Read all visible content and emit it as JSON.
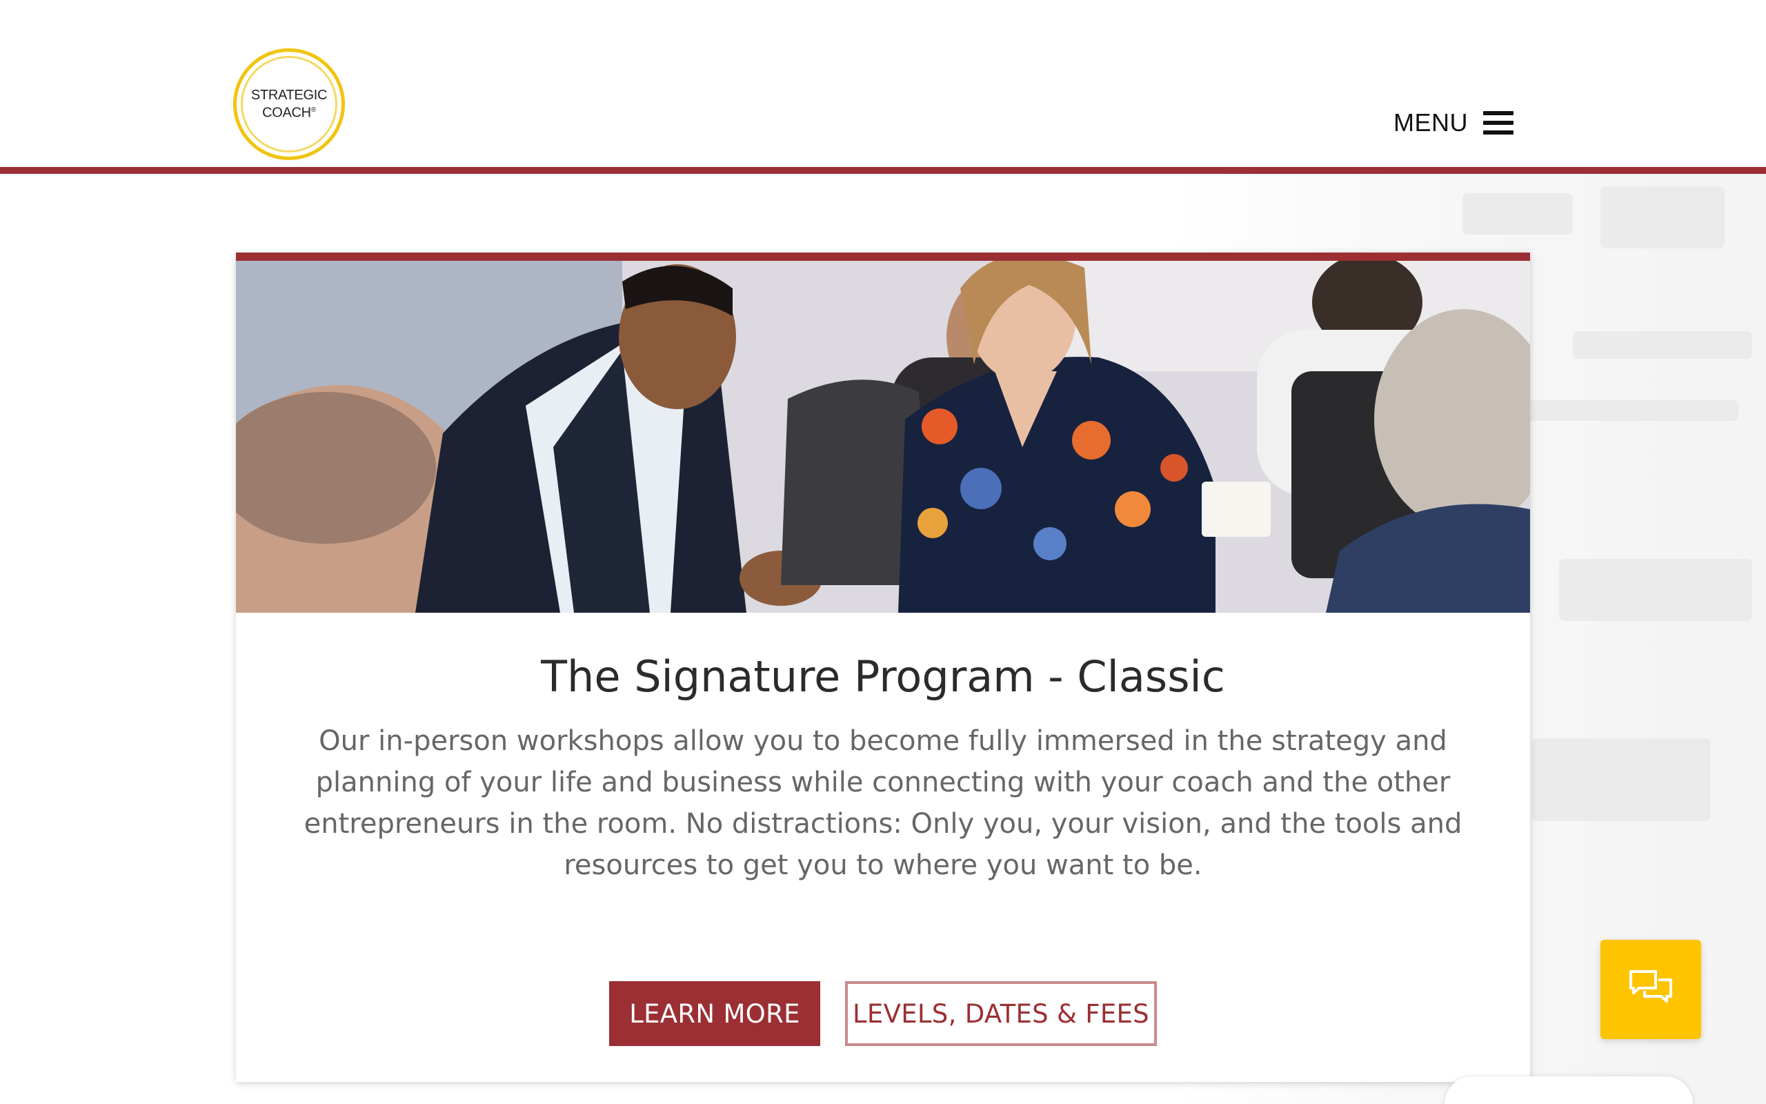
{
  "header": {
    "logo_line1": "STRATEGIC",
    "logo_line2": "COACH",
    "logo_mark": "®",
    "menu_label": "MENU",
    "menu_icon": "hamburger-icon"
  },
  "card": {
    "title": "The Signature Program - Classic",
    "description": "Our in-person workshops allow you to become fully immersed in the strategy and planning of your life and business while connecting with your coach and the other entrepreneurs in the room. No distractions: Only you, your vision, and the tools and resources to get you to where you want to be.",
    "buttons": {
      "learn_more": "LEARN MORE",
      "levels": "LEVELS, DATES & FEES"
    }
  },
  "chat": {
    "icon": "chat-bubbles-icon"
  },
  "colors": {
    "brand_red": "#9b2f33",
    "outline_red": "#c98b8e",
    "logo_gold": "#f1c40f",
    "chat_yellow": "#ffc400"
  }
}
